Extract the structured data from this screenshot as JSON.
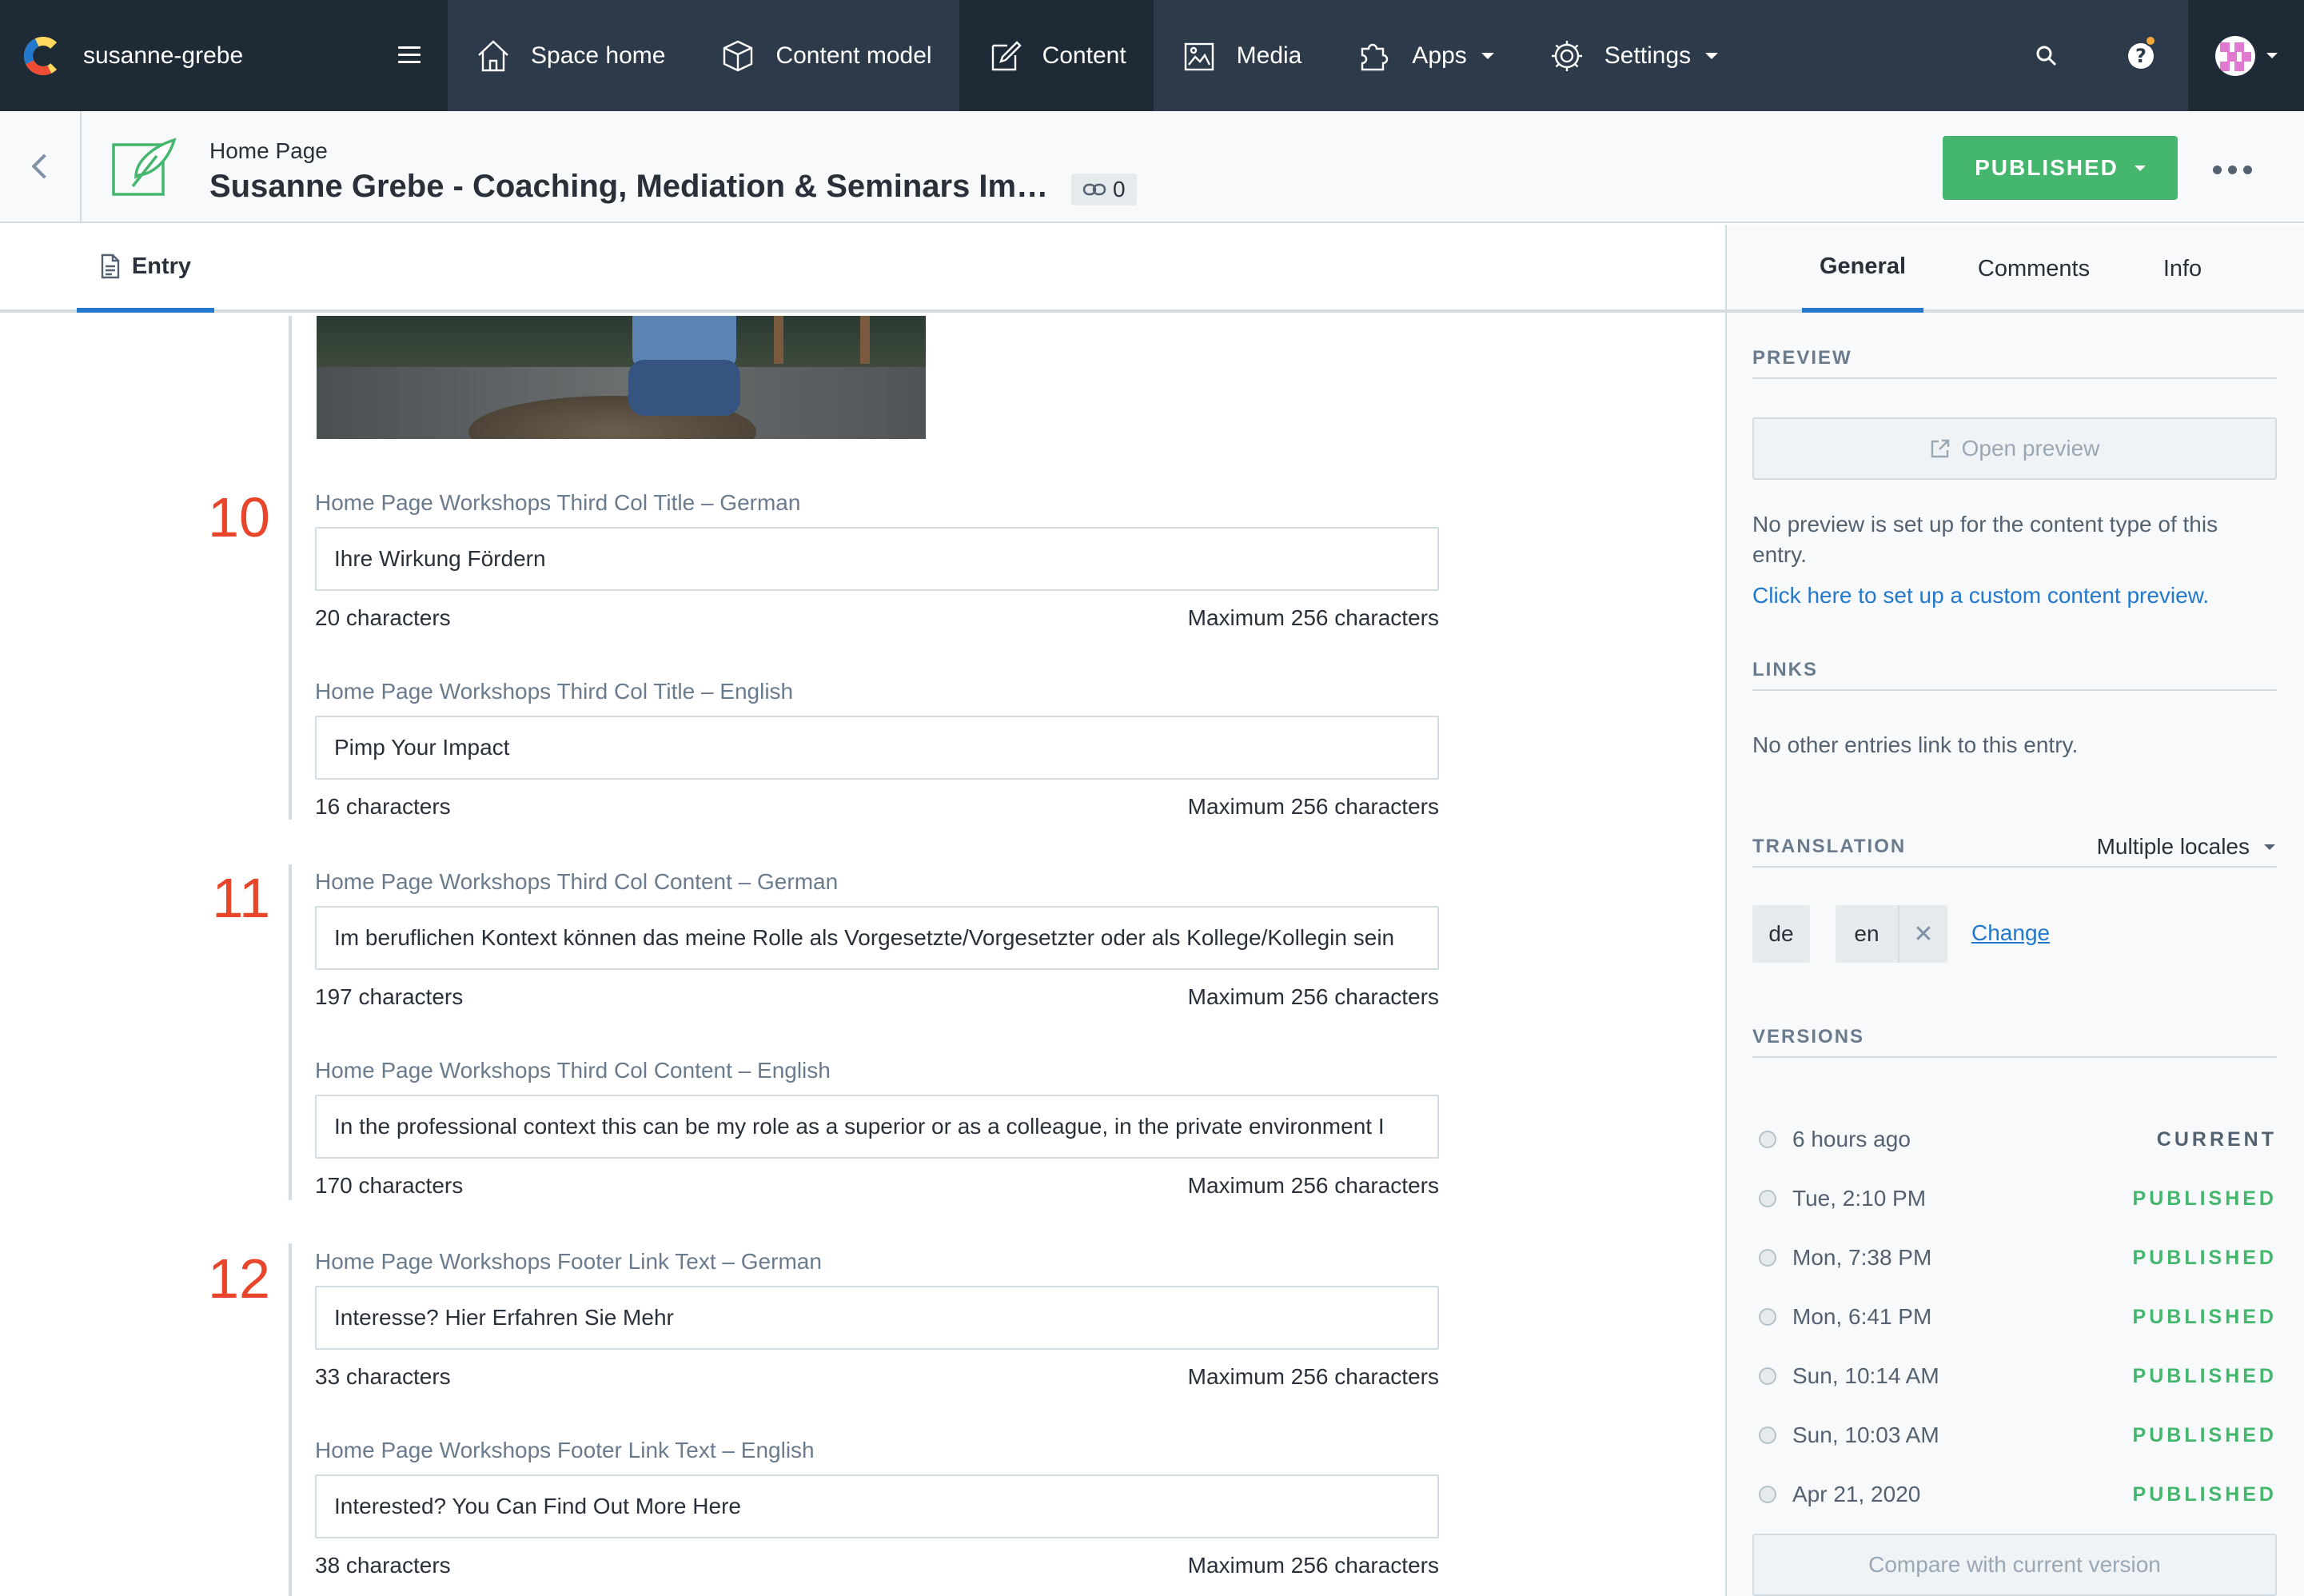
{
  "topnav": {
    "space_name": "susanne-grebe",
    "items": [
      {
        "label": "Space home",
        "icon": "home-icon"
      },
      {
        "label": "Content model",
        "icon": "cube-icon"
      },
      {
        "label": "Content",
        "icon": "edit-icon"
      },
      {
        "label": "Media",
        "icon": "image-icon"
      },
      {
        "label": "Apps",
        "icon": "puzzle-icon"
      },
      {
        "label": "Settings",
        "icon": "gear-icon"
      }
    ],
    "active": "Content"
  },
  "entry_header": {
    "content_type": "Home Page",
    "title": "Susanne Grebe - Coaching, Mediation & Seminars Im…",
    "reference_count": "0",
    "status": "PUBLISHED"
  },
  "entry_tabs": {
    "entry": "Entry"
  },
  "fields": [
    {
      "number": "10",
      "items": [
        {
          "label": "Home Page Workshops Third Col Title – German",
          "value": "Ihre Wirkung Fördern",
          "count": "20 characters",
          "max": "Maximum 256 characters"
        },
        {
          "label": "Home Page Workshops Third Col Title – English",
          "value": "Pimp Your Impact",
          "count": "16 characters",
          "max": "Maximum 256 characters"
        }
      ]
    },
    {
      "number": "11",
      "items": [
        {
          "label": "Home Page Workshops Third Col Content – German",
          "value": "Im beruflichen Kontext können das meine Rolle als Vorgesetzte/Vorgesetzter oder als Kollege/Kollegin sein",
          "count": "197 characters",
          "max": "Maximum 256 characters"
        },
        {
          "label": "Home Page Workshops Third Col Content – English",
          "value": "In the professional context this can be my role as a superior or as a colleague, in the private environment I",
          "count": "170 characters",
          "max": "Maximum 256 characters"
        }
      ]
    },
    {
      "number": "12",
      "items": [
        {
          "label": "Home Page Workshops Footer Link Text – German",
          "value": "Interesse? Hier Erfahren Sie Mehr",
          "count": "33 characters",
          "max": "Maximum 256 characters"
        },
        {
          "label": "Home Page Workshops Footer Link Text – English",
          "value": "Interested? You Can Find Out More Here",
          "count": "38 characters",
          "max": "Maximum 256 characters"
        }
      ]
    }
  ],
  "sidebar": {
    "tabs": [
      "General",
      "Comments",
      "Info"
    ],
    "active_tab": "General",
    "preview": {
      "heading": "PREVIEW",
      "button": "Open preview",
      "note": "No preview is set up for the content type of this entry.",
      "link": "Click here to set up a custom content preview."
    },
    "links": {
      "heading": "LINKS",
      "note": "No other entries link to this entry."
    },
    "translation": {
      "heading": "TRANSLATION",
      "mode": "Multiple locales",
      "locales": [
        "de",
        "en"
      ],
      "change": "Change"
    },
    "versions": {
      "heading": "VERSIONS",
      "items": [
        {
          "date": "6 hours ago",
          "status": "CURRENT"
        },
        {
          "date": "Tue, 2:10 PM",
          "status": "PUBLISHED"
        },
        {
          "date": "Mon, 7:38 PM",
          "status": "PUBLISHED"
        },
        {
          "date": "Mon, 6:41 PM",
          "status": "PUBLISHED"
        },
        {
          "date": "Sun, 10:14 AM",
          "status": "PUBLISHED"
        },
        {
          "date": "Sun, 10:03 AM",
          "status": "PUBLISHED"
        },
        {
          "date": "Apr 21, 2020",
          "status": "PUBLISHED"
        }
      ],
      "compare": "Compare with current version"
    }
  },
  "colors": {
    "nav_bg": "#2d3a4a",
    "nav_active": "#1f2a37",
    "published_green": "#44b66d",
    "link_blue": "#2478cc",
    "field_number_red": "#e8452b"
  }
}
